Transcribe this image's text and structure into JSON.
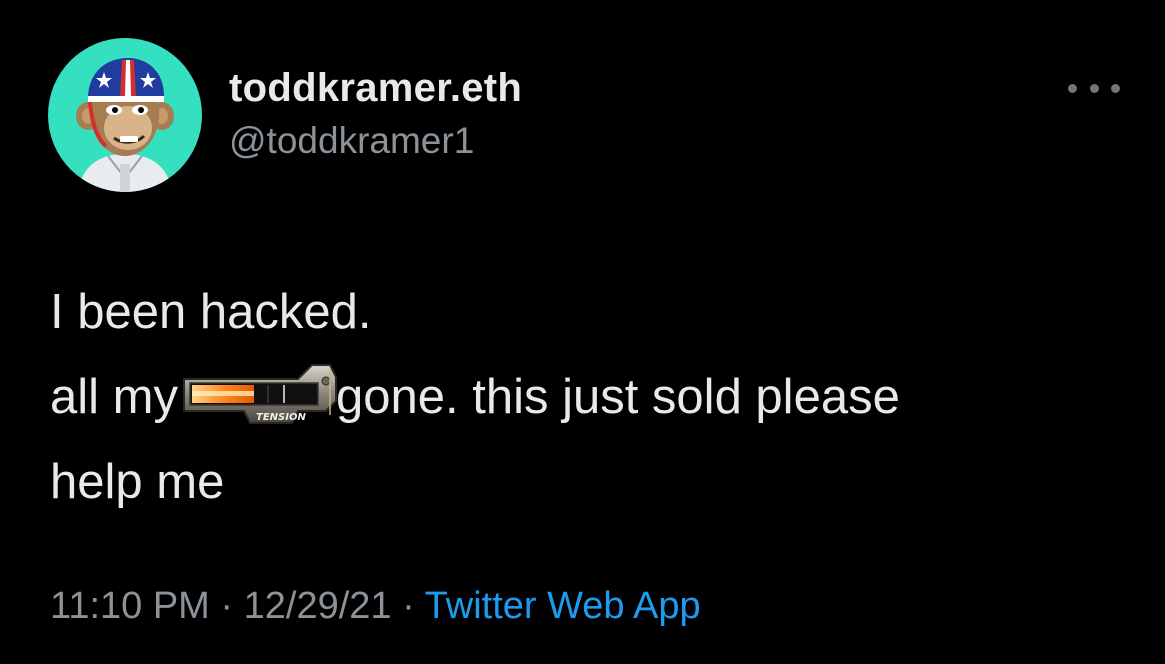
{
  "author": {
    "display_name": "toddkramer.eth",
    "handle": "@toddkramer1",
    "avatar_icon": "bored-ape-avatar-icon",
    "avatar_bg": "#35e0c0"
  },
  "actions": {
    "more_icon": "more-horizontal-icon"
  },
  "tweet": {
    "line1": "I been hacked.",
    "line2_before": "all my",
    "sticker_icon": "tension-meter-sticker-icon",
    "sticker_text": "TENSION",
    "line2_after": "gone. this just sold please",
    "line3": "help me"
  },
  "meta": {
    "time": "11:10 PM",
    "separator": " · ",
    "date": "12/29/21",
    "source": "Twitter Web App",
    "source_color": "#1d9bf0"
  }
}
